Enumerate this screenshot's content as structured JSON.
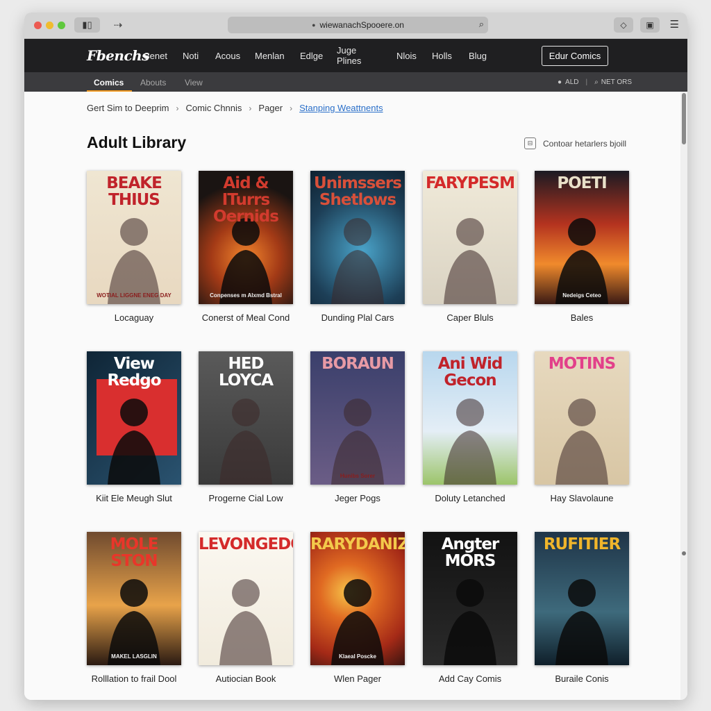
{
  "browser": {
    "url": "wiewanachSpooere.on"
  },
  "site": {
    "logo": "Fbenchs",
    "nav": [
      "Senet",
      "Noti",
      "Acous",
      "Menlan",
      "Edlge",
      "Juge Plines",
      "Nlois",
      "Holls",
      "Blug"
    ],
    "cta": "Edur Comics"
  },
  "subnav": {
    "tabs": [
      "Comics",
      "Abouts",
      "View"
    ],
    "active": "Comics",
    "right_a": "ALD",
    "right_b": "NET ORS"
  },
  "breadcrumb": [
    "Gert Sim to Deeprim",
    "Comic Chnnis",
    "Pager",
    "Stanping Weattnents"
  ],
  "page_title": "Adult Library",
  "filter_label": "Contoar hetarlers bjoill",
  "comics": [
    {
      "caption": "Locaguay",
      "cover_title": "BEAKE THIUS",
      "cover_sub": "WOTIAL LIGGNE ENEG DAY",
      "bg": "#efe6d2",
      "title_color": "#c0232b",
      "style": "light"
    },
    {
      "caption": "Conerst of Meal Cond",
      "cover_title": "Aid & ITurrs Oernids",
      "cover_sub": "Conpenses m Alxmd Bstral",
      "bg": "#1a1412",
      "title_color": "#d23b2e",
      "style": "fire"
    },
    {
      "caption": "Dunding Plal Cars",
      "cover_title": "Unimssers Shetlows",
      "cover_sub": "",
      "bg": "#1d3f57",
      "title_color": "#d8503a",
      "style": "blue"
    },
    {
      "caption": "Caper Bluls",
      "cover_title": "FARYPESM",
      "cover_sub": "",
      "bg": "#f0ead9",
      "title_color": "#d42a2a",
      "style": "hero"
    },
    {
      "caption": "Bales",
      "cover_title": "POETI",
      "cover_sub": "Nedeigs Ceteo",
      "bg": "#1b1a22",
      "title_color": "#e9e0c9",
      "style": "sunset"
    },
    {
      "caption": "Kiit Ele Meugh Slut",
      "cover_title": "View Redgo",
      "cover_sub": "",
      "bg": "#163246",
      "title_color": "#ffffff",
      "style": "redsquare"
    },
    {
      "caption": "Progerne Cial Low",
      "cover_title": "HED LOYCA",
      "cover_sub": "",
      "bg": "#4b4b4b",
      "title_color": "#ffffff",
      "style": "grey"
    },
    {
      "caption": "Jeger Pogs",
      "cover_title": "BORAUN",
      "cover_sub": "Hunibs Sorer",
      "bg": "#3a3f6b",
      "title_color": "#e79aa5",
      "style": "portrait"
    },
    {
      "caption": "Doluty Letanched",
      "cover_title": "Ani Wid Gecon",
      "cover_sub": "",
      "bg": "#b8d7ee",
      "title_color": "#c0232b",
      "style": "sky"
    },
    {
      "caption": "Hay Slavolaune",
      "cover_title": "MOTINS",
      "cover_sub": "",
      "bg": "#e7d9bf",
      "title_color": "#e2408a",
      "style": "pinup"
    },
    {
      "caption": "Rolllation to frail Dool",
      "cover_title": "MOLE STON",
      "cover_sub": "MAKEL LASGLIN",
      "bg": "#3a2418",
      "title_color": "#e8362a",
      "style": "dusk"
    },
    {
      "caption": "Autiocian Book",
      "cover_title": "LEVONGEDO",
      "cover_sub": "",
      "bg": "#fbf8f1",
      "title_color": "#d42a2a",
      "style": "fairy"
    },
    {
      "caption": "Wlen Pager",
      "cover_title": "RARYDANIZ",
      "cover_sub": "Klaeal Poscke",
      "bg": "#c4381f",
      "title_color": "#f3c94b",
      "style": "ninja"
    },
    {
      "caption": "Add Cay Comis",
      "cover_title": "Angter MORS",
      "cover_sub": "",
      "bg": "#121212",
      "title_color": "#ffffff",
      "style": "noir"
    },
    {
      "caption": "Buraile Conis",
      "cover_title": "RUFITIER",
      "cover_sub": "",
      "bg": "#1f3447",
      "title_color": "#f0b52b",
      "style": "city"
    }
  ],
  "colors": {
    "accent": "#f29a21",
    "link": "#2a6fc9",
    "nav_bg": "#1f1f21",
    "subnav_bg": "#3b3b3e"
  }
}
